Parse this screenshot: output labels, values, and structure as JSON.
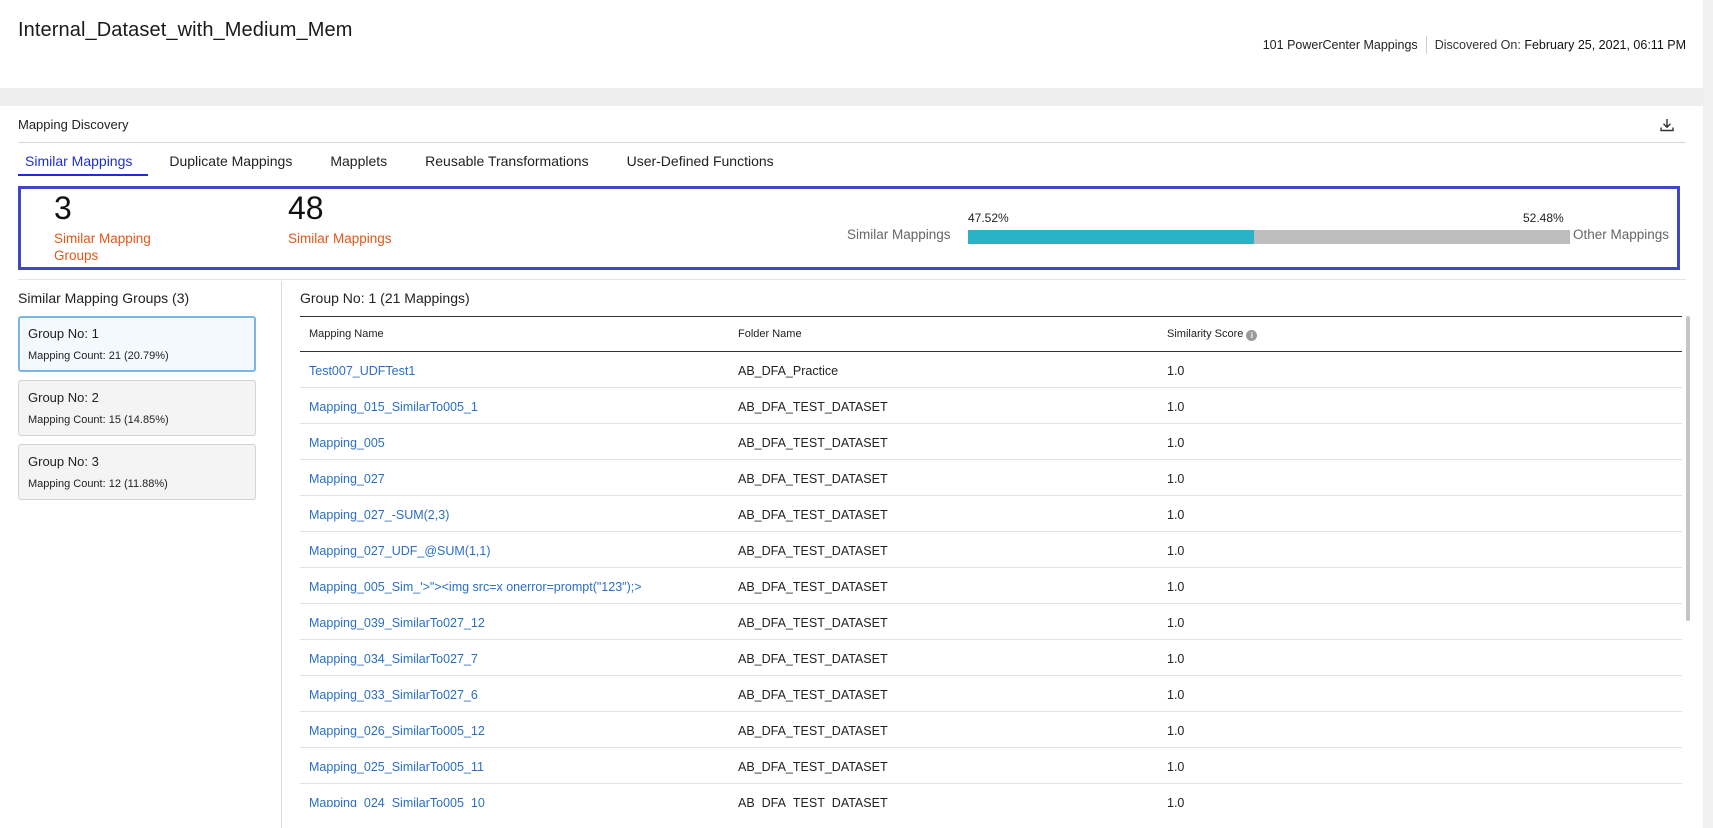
{
  "header": {
    "title": "Internal_Dataset_with_Medium_Mem",
    "mapping_count": "101 PowerCenter Mappings",
    "discovered_label": "Discovered On:",
    "discovered_value": "February 25, 2021, 06:11 PM"
  },
  "section": {
    "title": "Mapping Discovery",
    "download_icon": "download-icon"
  },
  "tabs": [
    {
      "label": "Similar Mappings",
      "active": true
    },
    {
      "label": "Duplicate Mappings",
      "active": false
    },
    {
      "label": "Mapplets",
      "active": false
    },
    {
      "label": "Reusable Transformations",
      "active": false
    },
    {
      "label": "User-Defined Functions",
      "active": false
    }
  ],
  "summary": {
    "groups_count": "3",
    "groups_label": "Similar Mapping Groups",
    "mappings_count": "48",
    "mappings_label": "Similar Mappings",
    "bar": {
      "left_label": "Similar Mappings",
      "right_label": "Other Mappings",
      "left_pct_text": "47.52%",
      "right_pct_text": "52.48%",
      "similar_percent": 47.52,
      "fill_color": "#2ab2c8",
      "track_color": "#bdbdbd"
    }
  },
  "groups": {
    "title": "Similar Mapping Groups (3)",
    "items": [
      {
        "name": "Group No: 1",
        "count": "Mapping Count: 21 (20.79%)",
        "selected": true
      },
      {
        "name": "Group No: 2",
        "count": "Mapping Count: 15 (14.85%)",
        "selected": false
      },
      {
        "name": "Group No: 3",
        "count": "Mapping Count: 12 (11.88%)",
        "selected": false
      }
    ]
  },
  "table": {
    "title": "Group No: 1 (21 Mappings)",
    "columns": [
      "Mapping Name",
      "Folder Name",
      "Similarity Score"
    ],
    "rows": [
      [
        "Test007_UDFTest1",
        "AB_DFA_Practice",
        "1.0"
      ],
      [
        "Mapping_015_SimilarTo005_1",
        "AB_DFA_TEST_DATASET",
        "1.0"
      ],
      [
        "Mapping_005",
        "AB_DFA_TEST_DATASET",
        "1.0"
      ],
      [
        "Mapping_027",
        "AB_DFA_TEST_DATASET",
        "1.0"
      ],
      [
        "Mapping_027_-SUM(2,3)",
        "AB_DFA_TEST_DATASET",
        "1.0"
      ],
      [
        "Mapping_027_UDF_@SUM(1,1)",
        "AB_DFA_TEST_DATASET",
        "1.0"
      ],
      [
        "Mapping_005_Sim_'>\"><img src=x onerror=prompt(\"123\");>",
        "AB_DFA_TEST_DATASET",
        "1.0"
      ],
      [
        "Mapping_039_SimilarTo027_12",
        "AB_DFA_TEST_DATASET",
        "1.0"
      ],
      [
        "Mapping_034_SimilarTo027_7",
        "AB_DFA_TEST_DATASET",
        "1.0"
      ],
      [
        "Mapping_033_SimilarTo027_6",
        "AB_DFA_TEST_DATASET",
        "1.0"
      ],
      [
        "Mapping_026_SimilarTo005_12",
        "AB_DFA_TEST_DATASET",
        "1.0"
      ],
      [
        "Mapping_025_SimilarTo005_11",
        "AB_DFA_TEST_DATASET",
        "1.0"
      ],
      [
        "Mapping_024_SimilarTo005_10",
        "AB_DFA_TEST_DATASET",
        "1.0"
      ]
    ]
  }
}
